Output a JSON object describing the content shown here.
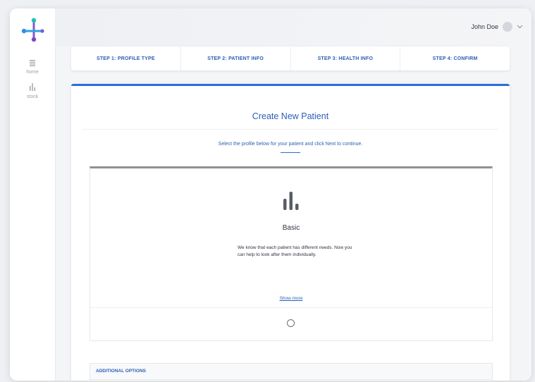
{
  "sidebar": {
    "items": [
      {
        "label": "home",
        "icon": "home-icon"
      },
      {
        "label": "stock",
        "icon": "stock-chart-icon"
      }
    ]
  },
  "header": {
    "user_name": "John Doe"
  },
  "steps": [
    {
      "label": "STEP 1: PROFILE TYPE"
    },
    {
      "label": "STEP 2: PATIENT INFO"
    },
    {
      "label": "STEP 3: HEALTH INFO"
    },
    {
      "label": "STEP 4: CONFIRM"
    }
  ],
  "main": {
    "title": "Create New Patient",
    "instructions": "Select the profile below for your patient and click Next to continue.",
    "profile_card": {
      "icon": "bar-chart-icon",
      "title": "Basic",
      "description": "We know that each patient has different needs. Now you can help to look after them individually.",
      "show_more": "Show more"
    },
    "additional_options": {
      "title": "ADDITIONAL OPTIONS"
    }
  },
  "colors": {
    "accent": "#2b6ed6",
    "link": "#2b5fb3",
    "text": "#2f3440"
  }
}
